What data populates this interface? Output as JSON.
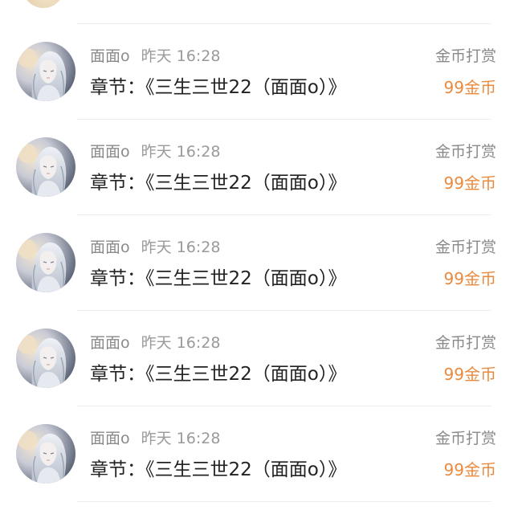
{
  "records": [
    {
      "user": "面面o",
      "time": "昨天 16:28",
      "chapter": "章节：《三生三世22（面面o）》",
      "type": "金币打赏",
      "amount": "99金币"
    },
    {
      "user": "面面o",
      "time": "昨天 16:28",
      "chapter": "章节：《三生三世22（面面o）》",
      "type": "金币打赏",
      "amount": "99金币"
    },
    {
      "user": "面面o",
      "time": "昨天 16:28",
      "chapter": "章节：《三生三世22（面面o）》",
      "type": "金币打赏",
      "amount": "99金币"
    },
    {
      "user": "面面o",
      "time": "昨天 16:28",
      "chapter": "章节：《三生三世22（面面o）》",
      "type": "金币打赏",
      "amount": "99金币"
    },
    {
      "user": "面面o",
      "time": "昨天 16:28",
      "chapter": "章节：《三生三世22（面面o）》",
      "type": "金币打赏",
      "amount": "99金币"
    }
  ],
  "colors": {
    "amount": "#e98a3f",
    "secondary_text": "#8a8a8a",
    "primary_text": "#222222"
  }
}
